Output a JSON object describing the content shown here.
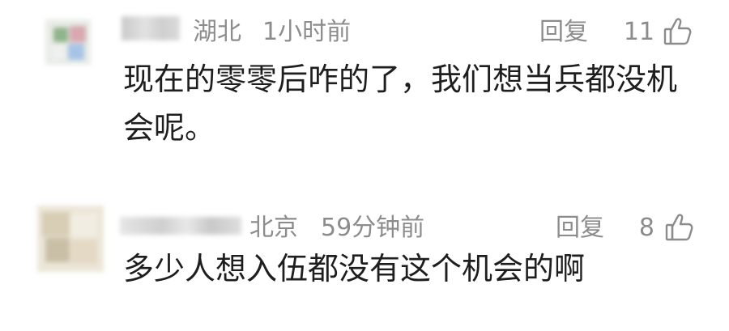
{
  "comments": [
    {
      "location": "湖北",
      "time": "1小时前",
      "reply_label": "回复",
      "likes": "11",
      "text": "现在的零零后咋的了，我们想当兵都没机会呢。"
    },
    {
      "location": "北京",
      "time": "59分钟前",
      "reply_label": "回复",
      "likes": "8",
      "text": "多少人想入伍都没有这个机会的啊"
    }
  ],
  "icons": {
    "like": "thumbs-up-outline-icon"
  },
  "colors": {
    "meta_text": "#8c8c8c",
    "body_text": "#1e1e1e",
    "background": "#ffffff"
  }
}
